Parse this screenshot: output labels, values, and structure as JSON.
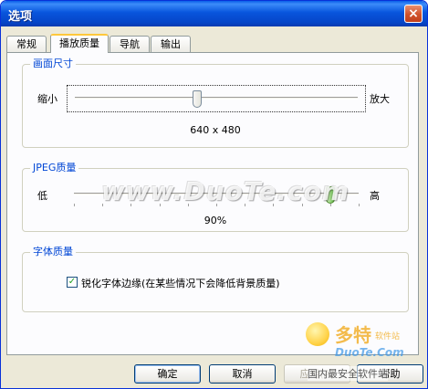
{
  "window": {
    "title": "选项",
    "close_glyph": "×"
  },
  "tabs": [
    {
      "label": "常规"
    },
    {
      "label": "播放质量"
    },
    {
      "label": "导航"
    },
    {
      "label": "输出"
    }
  ],
  "groups": {
    "size": {
      "title": "画面尺寸",
      "min_label": "缩小",
      "max_label": "放大",
      "value_text": "640 x 480",
      "slider_fraction": 0.43
    },
    "jpeg": {
      "title": "JPEG质量",
      "min_label": "低",
      "max_label": "高",
      "value_text": "90%",
      "slider_fraction": 0.9
    },
    "font": {
      "title": "字体质量",
      "checkbox_label": "锐化字体边缘(在某些情况下会降低背景质量)",
      "checked": true
    }
  },
  "buttons": {
    "ok": "确定",
    "cancel": "取消",
    "apply": "应用(A)",
    "help": "帮助"
  },
  "watermark": {
    "text": "www.DuoTe.com",
    "logo_main": "多特",
    "logo_sub": "软件站",
    "logo_site": "DuoTe.Com",
    "logo_tag": "国内最安全软件站"
  },
  "colors": {
    "title_bar": "#0855dd",
    "group_title": "#0046d5",
    "panel_bg": "#fcfcfe",
    "dialog_bg": "#ece9d8"
  }
}
